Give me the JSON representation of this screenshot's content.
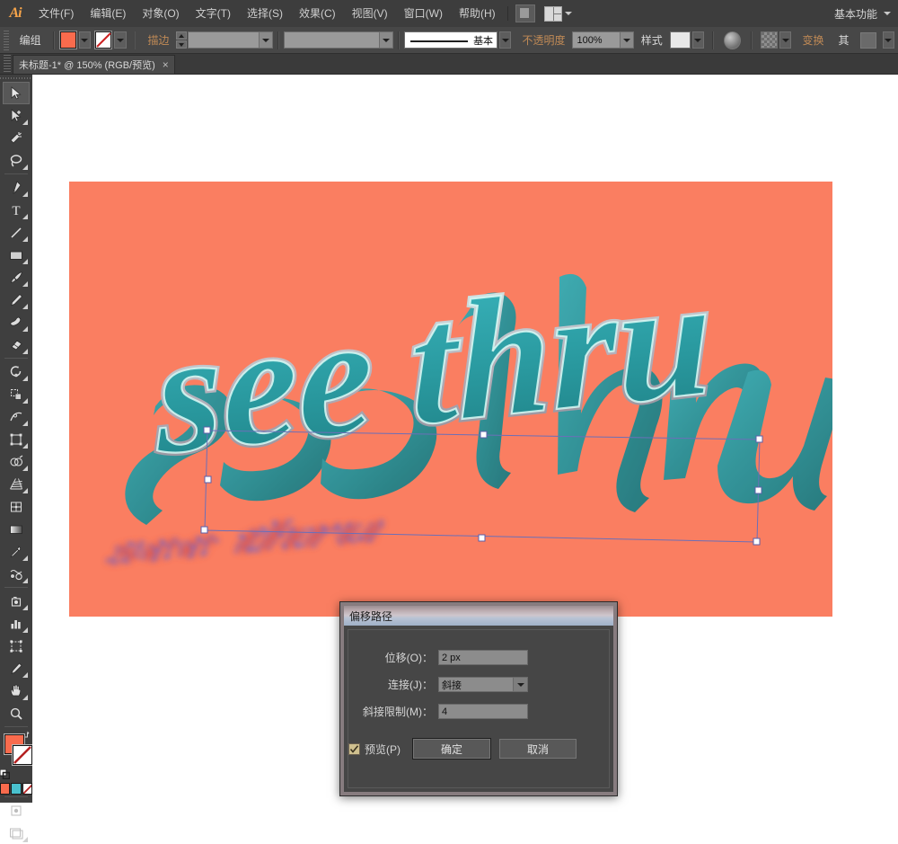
{
  "app": {
    "logo": "Ai",
    "workspace_label": "基本功能"
  },
  "menu": {
    "items": [
      {
        "label": "文件(F)"
      },
      {
        "label": "编辑(E)"
      },
      {
        "label": "对象(O)"
      },
      {
        "label": "文字(T)"
      },
      {
        "label": "选择(S)"
      },
      {
        "label": "效果(C)"
      },
      {
        "label": "视图(V)"
      },
      {
        "label": "窗口(W)"
      },
      {
        "label": "帮助(H)"
      }
    ]
  },
  "control_bar": {
    "selection_type": "编组",
    "fill_color": "#f96b4d",
    "stroke_label": "描边",
    "stroke_weight": "",
    "stroke_profile": "",
    "brush_definition": "基本",
    "opacity_label": "不透明度",
    "opacity_value": "100%",
    "style_label": "样式",
    "transform_label": "变换",
    "align_label": "其",
    "isolate_label": ""
  },
  "document_tab": {
    "title": "未标题-1* @ 150% (RGB/预览)",
    "close": "×"
  },
  "toolbar": {
    "tools": [
      {
        "name": "selection-tool",
        "title": "选择工具"
      },
      {
        "name": "direct-selection-tool",
        "title": "直接选择工具"
      },
      {
        "name": "magic-wand-tool",
        "title": "魔棒工具"
      },
      {
        "name": "lasso-tool",
        "title": "套索工具"
      },
      {
        "name": "pen-tool",
        "title": "钢笔工具"
      },
      {
        "name": "type-tool",
        "title": "文字工具"
      },
      {
        "name": "line-segment-tool",
        "title": "直线段工具"
      },
      {
        "name": "rectangle-tool",
        "title": "矩形工具"
      },
      {
        "name": "paintbrush-tool",
        "title": "画笔工具"
      },
      {
        "name": "pencil-tool",
        "title": "铅笔工具"
      },
      {
        "name": "blob-brush-tool",
        "title": "斑点画笔工具"
      },
      {
        "name": "eraser-tool",
        "title": "橡皮擦工具"
      },
      {
        "name": "rotate-tool",
        "title": "旋转工具"
      },
      {
        "name": "scale-tool",
        "title": "比例缩放工具"
      },
      {
        "name": "width-tool",
        "title": "宽度工具"
      },
      {
        "name": "free-transform-tool",
        "title": "自由变换工具"
      },
      {
        "name": "shape-builder-tool",
        "title": "形状生成器工具"
      },
      {
        "name": "perspective-grid-tool",
        "title": "透视网格工具"
      },
      {
        "name": "mesh-tool",
        "title": "网格工具"
      },
      {
        "name": "gradient-tool",
        "title": "渐变工具"
      },
      {
        "name": "eyedropper-tool",
        "title": "吸管工具"
      },
      {
        "name": "blend-tool",
        "title": "混合工具"
      },
      {
        "name": "symbol-sprayer-tool",
        "title": "符号喷枪工具"
      },
      {
        "name": "column-graph-tool",
        "title": "柱形图工具"
      },
      {
        "name": "artboard-tool",
        "title": "画板工具"
      },
      {
        "name": "slice-tool",
        "title": "切片工具"
      },
      {
        "name": "hand-tool",
        "title": "抓手工具"
      },
      {
        "name": "zoom-tool",
        "title": "缩放工具"
      }
    ],
    "fill_color": "#f96b4d",
    "stroke_color": "none",
    "color_modes": [
      "#f96b4d",
      "#3dc0c8",
      "none"
    ]
  },
  "artwork": {
    "background_color": "#fa7e61",
    "text": "see thru",
    "letter_face_color": "#2f9b9b",
    "letter_extrude_color": "#1e8b8b",
    "letter_outline_color": "#bff3f0",
    "shadow_color_a": "#e8513d",
    "shadow_color_b": "#5566e8",
    "selection_color": "#8a8ad0"
  },
  "dialog": {
    "title": "偏移路径",
    "fields": [
      {
        "label": "位移(O)：",
        "value": "2  px",
        "type": "input"
      },
      {
        "label": "连接(J)：",
        "value": "斜接",
        "type": "select"
      },
      {
        "label": "斜接限制(M)：",
        "value": "4",
        "type": "input"
      }
    ],
    "preview_label": "预览(P)",
    "preview_checked": true,
    "ok_label": "确定",
    "cancel_label": "取消"
  }
}
